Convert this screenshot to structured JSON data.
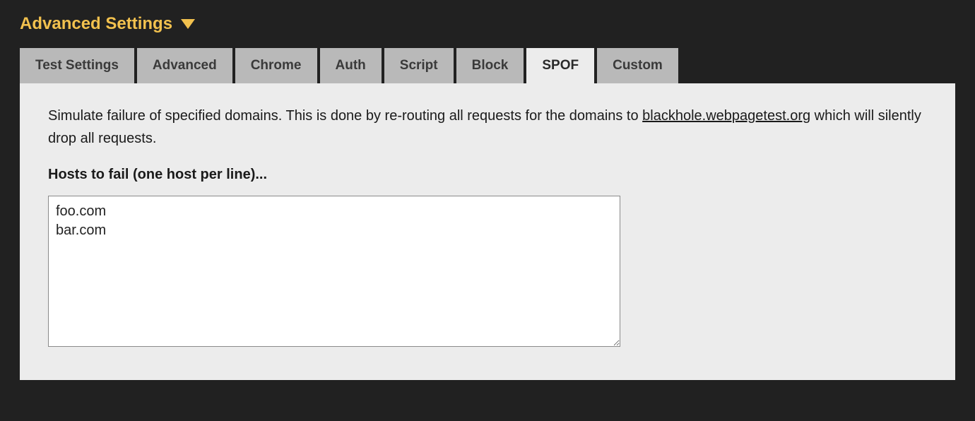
{
  "header": {
    "title": "Advanced Settings"
  },
  "tabs": [
    {
      "id": "test-settings",
      "label": "Test Settings",
      "active": false
    },
    {
      "id": "advanced",
      "label": "Advanced",
      "active": false
    },
    {
      "id": "chrome",
      "label": "Chrome",
      "active": false
    },
    {
      "id": "auth",
      "label": "Auth",
      "active": false
    },
    {
      "id": "script",
      "label": "Script",
      "active": false
    },
    {
      "id": "block",
      "label": "Block",
      "active": false
    },
    {
      "id": "spof",
      "label": "SPOF",
      "active": true
    },
    {
      "id": "custom",
      "label": "Custom",
      "active": false
    }
  ],
  "panel": {
    "description_pre": "Simulate failure of specified domains. This is done by re-routing all requests for the domains to ",
    "description_link": "blackhole.webpagetest.org",
    "description_post": " which will silently drop all requests.",
    "field_label": "Hosts to fail (one host per line)...",
    "hosts_value": "foo.com\nbar.com"
  }
}
